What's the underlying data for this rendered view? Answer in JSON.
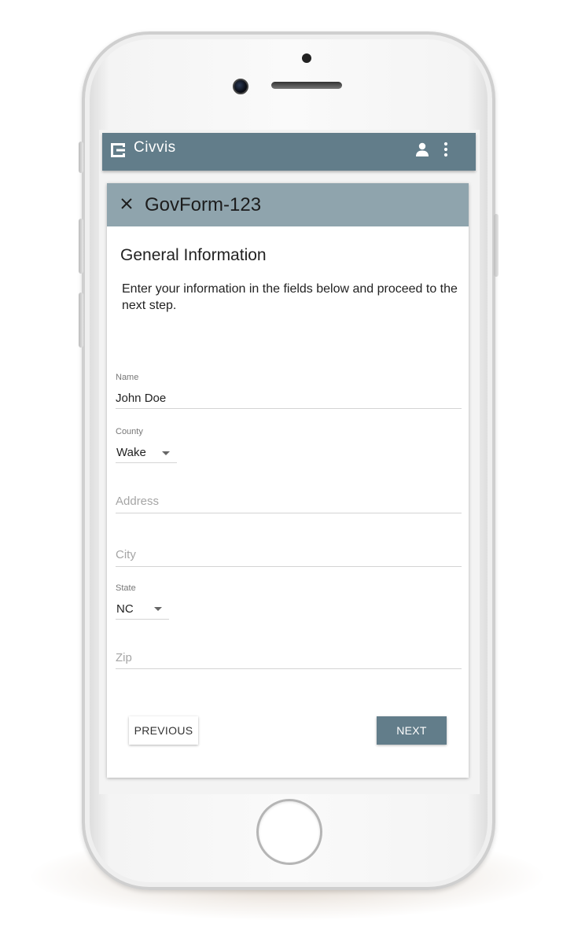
{
  "app": {
    "name": "Civvis",
    "icons": {
      "logo": "civvis-logo-icon",
      "user": "user-icon",
      "more": "more-vert-icon",
      "close": "close-icon",
      "dropdown": "caret-down-icon"
    },
    "colors": {
      "appbar": "#627d8a",
      "card_header": "#8fa4ad",
      "primary_button": "#627d8a"
    }
  },
  "form": {
    "title": "GovForm-123",
    "section_title": "General Information",
    "description": "Enter your information in the fields below and proceed to the next step.",
    "fields": {
      "name": {
        "label": "Name",
        "value": "John Doe"
      },
      "county": {
        "label": "County",
        "value": "Wake"
      },
      "address": {
        "placeholder": "Address"
      },
      "city": {
        "placeholder": "City"
      },
      "state": {
        "label": "State",
        "value": "NC"
      },
      "zip": {
        "placeholder": "Zip"
      }
    },
    "buttons": {
      "previous": "PREVIOUS",
      "next": "NEXT"
    }
  }
}
